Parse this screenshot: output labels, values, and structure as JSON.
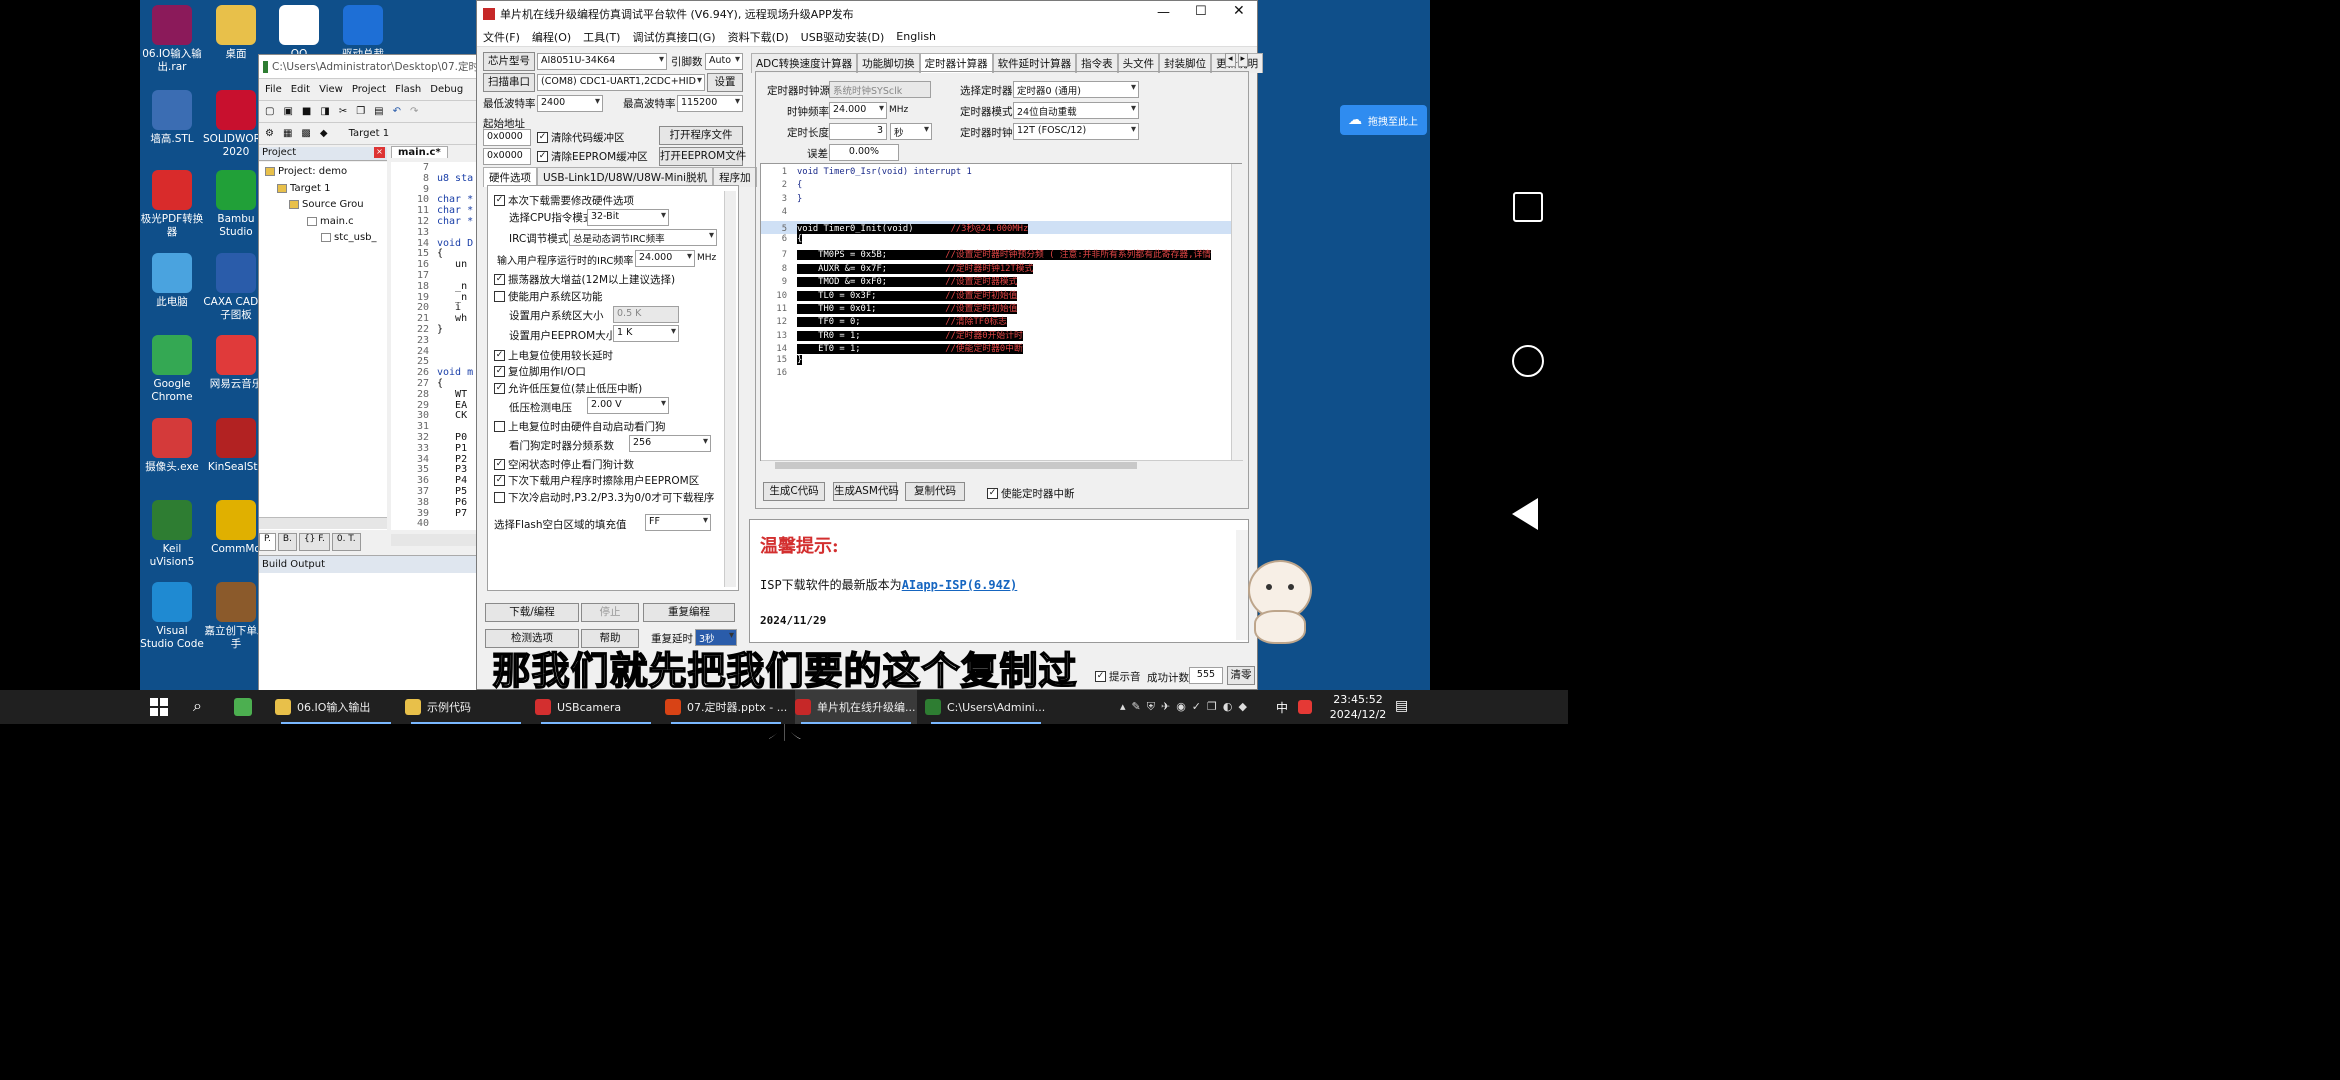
{
  "desktop": {
    "icons": [
      {
        "label": "06.IO输入输出.rar",
        "icon": "winrar-icon",
        "color": "#8b1a5a"
      },
      {
        "label": "桌面",
        "icon": "folder-icon",
        "color": "#e8c04a"
      },
      {
        "label": "QQ",
        "icon": "qq-icon",
        "color": "#ffffff"
      },
      {
        "label": "驱动总裁",
        "icon": "driver-icon",
        "color": "#1e6fd6"
      },
      {
        "label": "墙高.STL",
        "icon": "stl-icon",
        "color": "#3b6db3"
      },
      {
        "label": "SOLIDWORKS 2020",
        "icon": "solidworks-icon",
        "color": "#c8102e"
      },
      {
        "label": "极光PDF转换器",
        "icon": "pdf-icon",
        "color": "#d92b2b"
      },
      {
        "label": "Bambu Studio",
        "icon": "bambu-icon",
        "color": "#21a038"
      },
      {
        "label": "此电脑",
        "icon": "computer-icon",
        "color": "#4aa3df"
      },
      {
        "label": "CAXA CAD电子图板",
        "icon": "caxa-icon",
        "color": "#2a5caa"
      },
      {
        "label": "Google Chrome",
        "icon": "chrome-icon",
        "color": "#34a853"
      },
      {
        "label": "网易云音乐",
        "icon": "music-icon",
        "color": "#e03a3a"
      },
      {
        "label": "摄像头.exe",
        "icon": "camera-icon",
        "color": "#d43a3a"
      },
      {
        "label": "KinSealStu",
        "icon": "seal-icon",
        "color": "#b22222"
      },
      {
        "label": "Keil uVision5",
        "icon": "keil-icon",
        "color": "#2e7d32"
      },
      {
        "label": "CommMo",
        "icon": "commmo-icon",
        "color": "#e0b000"
      },
      {
        "label": "Visual Studio Code",
        "icon": "vscode-icon",
        "color": "#1f8ad2"
      },
      {
        "label": "嘉立创下单助手",
        "icon": "jlc-icon",
        "color": "#8b5a2b"
      }
    ]
  },
  "keil": {
    "title": "C:\\Users\\Administrator\\Desktop\\07.定时",
    "menu": [
      "File",
      "Edit",
      "View",
      "Project",
      "Flash",
      "Debug"
    ],
    "target": "Target 1",
    "project_panel_title": "Project",
    "tree": [
      "Project: demo",
      "Target 1",
      "Source Grou",
      "main.c",
      "stc_usb_"
    ],
    "editor_tab": "main.c*",
    "bottom_tabs": [
      "P.",
      "B.",
      "{} F.",
      "0. T."
    ],
    "lines": [
      {
        "n": "7",
        "t": ""
      },
      {
        "n": "8",
        "t": "u8 sta"
      },
      {
        "n": "9",
        "t": ""
      },
      {
        "n": "10",
        "t": "char *"
      },
      {
        "n": "11",
        "t": "char *"
      },
      {
        "n": "12",
        "t": "char *"
      },
      {
        "n": "13",
        "t": ""
      },
      {
        "n": "14",
        "t": "void D"
      },
      {
        "n": "15",
        "t": "{"
      },
      {
        "n": "16",
        "t": "   un"
      },
      {
        "n": "17",
        "t": ""
      },
      {
        "n": "18",
        "t": "   _n"
      },
      {
        "n": "19",
        "t": "   _n"
      },
      {
        "n": "20",
        "t": "   i"
      },
      {
        "n": "21",
        "t": "   wh"
      },
      {
        "n": "22",
        "t": "}"
      },
      {
        "n": "23",
        "t": ""
      },
      {
        "n": "24",
        "t": ""
      },
      {
        "n": "25",
        "t": ""
      },
      {
        "n": "26",
        "t": "void m"
      },
      {
        "n": "27",
        "t": "{"
      },
      {
        "n": "28",
        "t": "   WT"
      },
      {
        "n": "29",
        "t": "   EA"
      },
      {
        "n": "30",
        "t": "   CK"
      },
      {
        "n": "31",
        "t": ""
      },
      {
        "n": "32",
        "t": "   P0"
      },
      {
        "n": "33",
        "t": "   P1"
      },
      {
        "n": "34",
        "t": "   P2"
      },
      {
        "n": "35",
        "t": "   P3"
      },
      {
        "n": "36",
        "t": "   P4"
      },
      {
        "n": "37",
        "t": "   P5"
      },
      {
        "n": "38",
        "t": "   P6"
      },
      {
        "n": "39",
        "t": "   P7"
      },
      {
        "n": "40",
        "t": ""
      }
    ],
    "build_output": "Build Output"
  },
  "stc": {
    "title": "单片机在线升级编程仿真调试平台软件 (V6.94Y), 远程现场升级APP发布",
    "menu": [
      "文件(F)",
      "编程(O)",
      "工具(T)",
      "调试仿真接口(G)",
      "资料下载(D)",
      "USB驱动安装(D)",
      "English"
    ],
    "chip_label": "芯片型号",
    "chip_value": "AI8051U-34K64",
    "pin_label": "引脚数",
    "pin_value": "Auto",
    "scan_label": "扫描串口",
    "port_value": "(COM8) CDC1-UART1,2CDC+HID",
    "settings_label": "设置",
    "min_baud_label": "最低波特率",
    "min_baud_value": "2400",
    "max_baud_label": "最高波特率",
    "max_baud_value": "115200",
    "start_addr_label": "起始地址",
    "addr1": "0x0000",
    "clear_code": "清除代码缓冲区",
    "open_prog": "打开程序文件",
    "addr2": "0x0000",
    "clear_eeprom": "清除EEPROM缓冲区",
    "open_eeprom": "打开EEPROM文件",
    "left_tabs": [
      "硬件选项",
      "USB-Link1D/U8W/U8W-Mini脱机",
      "程序加"
    ],
    "options": {
      "o1": "本次下载需要修改硬件选项",
      "cpu_label": "选择CPU指令模式",
      "cpu_value": "32-Bit",
      "irc_label": "IRC调节模式",
      "irc_value": "总是动态调节IRC频率",
      "freq_label": "输入用户程序运行时的IRC频率",
      "freq_value": "24.000",
      "freq_unit": "MHz",
      "o2": "振荡器放大增益(12M以上建议选择)",
      "o3": "使能用户系统区功能",
      "sys_size_label": "设置用户系统区大小",
      "sys_size_value": "0.5 K",
      "eeprom_label": "设置用户EEPROM大小",
      "eeprom_value": "1    K",
      "o4": "上电复位使用较长延时",
      "o5": "复位脚用作I/O口",
      "o6": "允许低压复位(禁止低压中断)",
      "lv_label": "低压检测电压",
      "lv_value": "2.00 V",
      "o7": "上电复位时由硬件自动启动看门狗",
      "wd_label": "看门狗定时器分频系数",
      "wd_value": "256",
      "o8": "空闲状态时停止看门狗计数",
      "o9": "下次下载用户程序时擦除用户EEPROM区",
      "o10": "下次冷启动时,P3.2/P3.3为0/0才可下载程序",
      "fill_label": "选择Flash空白区域的填充值",
      "fill_value": "FF"
    },
    "btn_download": "下载/编程",
    "btn_stop": "停止",
    "btn_reprog": "重复编程",
    "btn_detect": "检测选项",
    "btn_help": "帮助",
    "btn_repeat_delay": "重复延时",
    "repeat_delay_value": "3秒",
    "right_tabs": [
      "ADC转换速度计算器",
      "功能脚切换",
      "定时器计算器",
      "软件延时计算器",
      "指令表",
      "头文件",
      "封装脚位",
      "更新说明"
    ],
    "timer": {
      "clk_src_label": "定时器时钟源",
      "clk_src_value": "系统时钟SYSclk",
      "sel_timer_label": "选择定时器",
      "sel_timer_value": "定时器0 (通用)",
      "clk_freq_label": "时钟频率",
      "clk_freq_value": "24.000",
      "clk_freq_unit": "MHz",
      "mode_label": "定时器模式",
      "mode_value": "24位自动重载",
      "len_label": "定时长度",
      "len_value": "3",
      "len_unit": "秒",
      "timer_clk_label": "定时器时钟",
      "timer_clk_value": "12T (FOSC/12)",
      "err_label": "误差",
      "err_value": "0.00%"
    },
    "code": [
      {
        "n": "1",
        "t": "void Timer0_Isr(void) interrupt 1",
        "c": ""
      },
      {
        "n": "2",
        "t": "{",
        "c": ""
      },
      {
        "n": "3",
        "t": "}",
        "c": ""
      },
      {
        "n": "4",
        "t": "",
        "c": ""
      },
      {
        "n": "5",
        "t": "void Timer0_Init(void)       ",
        "c": "//3秒@24.000MHz"
      },
      {
        "n": "6",
        "t": "{",
        "c": ""
      },
      {
        "n": "7",
        "t": "    TM0PS = 0x5B;           ",
        "c": "//设置定时器时钟预分频 ( 注意:并非所有系列都有此寄存器,详情"
      },
      {
        "n": "8",
        "t": "    AUXR &= 0x7F;           ",
        "c": "//定时器时钟12T模式"
      },
      {
        "n": "9",
        "t": "    TMOD &= 0xF0;           ",
        "c": "//设置定时器模式"
      },
      {
        "n": "10",
        "t": "    TL0 = 0x3F;             ",
        "c": "//设置定时初始值"
      },
      {
        "n": "11",
        "t": "    TH0 = 0x01;             ",
        "c": "//设置定时初始值"
      },
      {
        "n": "12",
        "t": "    TF0 = 0;                ",
        "c": "//清除TF0标志"
      },
      {
        "n": "13",
        "t": "    TR0 = 1;                ",
        "c": "//定时器0开始计时"
      },
      {
        "n": "14",
        "t": "    ET0 = 1;                ",
        "c": "//使能定时器0中断"
      },
      {
        "n": "15",
        "t": "}",
        "c": ""
      },
      {
        "n": "16",
        "t": "",
        "c": ""
      }
    ],
    "gen_c": "生成C代码",
    "gen_asm": "生成ASM代码",
    "copy_code": "复制代码",
    "enable_int": "使能定时器中断",
    "tip_title": "温馨提示:",
    "tip_line": "ISP下载软件的最新版本为",
    "tip_link": "AIapp-ISP(6.94Z)",
    "tip_date": "2024/11/29",
    "beep": "提示音",
    "count_label": "成功计数",
    "count_value": "555",
    "clear": "清零"
  },
  "floating_button": "拖拽至此上",
  "subtitle": "那我们就先把我们要的这个复制过来",
  "taskbar": {
    "items": [
      "06.IO输入输出",
      "示例代码",
      "USBcamera",
      "07.定时器.pptx - ...",
      "单片机在线升级编...",
      "C:\\Users\\Admini..."
    ],
    "ime": "中",
    "time": "23:45:52",
    "date": "2024/12/2"
  }
}
